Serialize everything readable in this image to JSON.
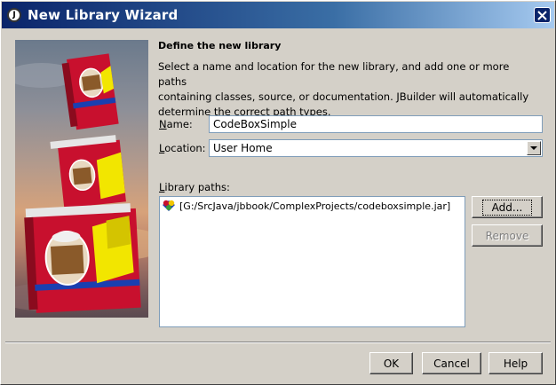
{
  "window": {
    "title": "New Library Wizard",
    "icon": "jbuilder-app-icon",
    "close_icon": "close-icon",
    "icon_letter": "J"
  },
  "step": {
    "heading": "Define the new library",
    "description_lines": [
      "Select a name and location for the new library, and add one or more paths",
      "containing classes, source, or documentation. JBuilder will automatically",
      "determine the correct path types."
    ]
  },
  "form": {
    "name_label_accel": "N",
    "name_label_rest": "ame:",
    "name_value": "CodeBoxSimple",
    "location_label_accel": "L",
    "location_label_rest": "ocation:",
    "location_value": "User Home",
    "paths_label_accel": "L",
    "paths_label_rest": "ibrary paths:",
    "paths": [
      "[G:/SrcJava/jbbook/ComplexProjects/codeboxsimple.jar]"
    ]
  },
  "side_buttons": {
    "add": "Add...",
    "remove": "Remove"
  },
  "footer_buttons": {
    "ok": "OK",
    "cancel": "Cancel",
    "help": "Help"
  },
  "colors": {
    "titlebar_start": "#0a246a",
    "titlebar_end": "#a6caf0",
    "dialog_bg": "#d4d0c8",
    "book_red": "#c8102e",
    "folder_yellow": "#f2e600"
  }
}
